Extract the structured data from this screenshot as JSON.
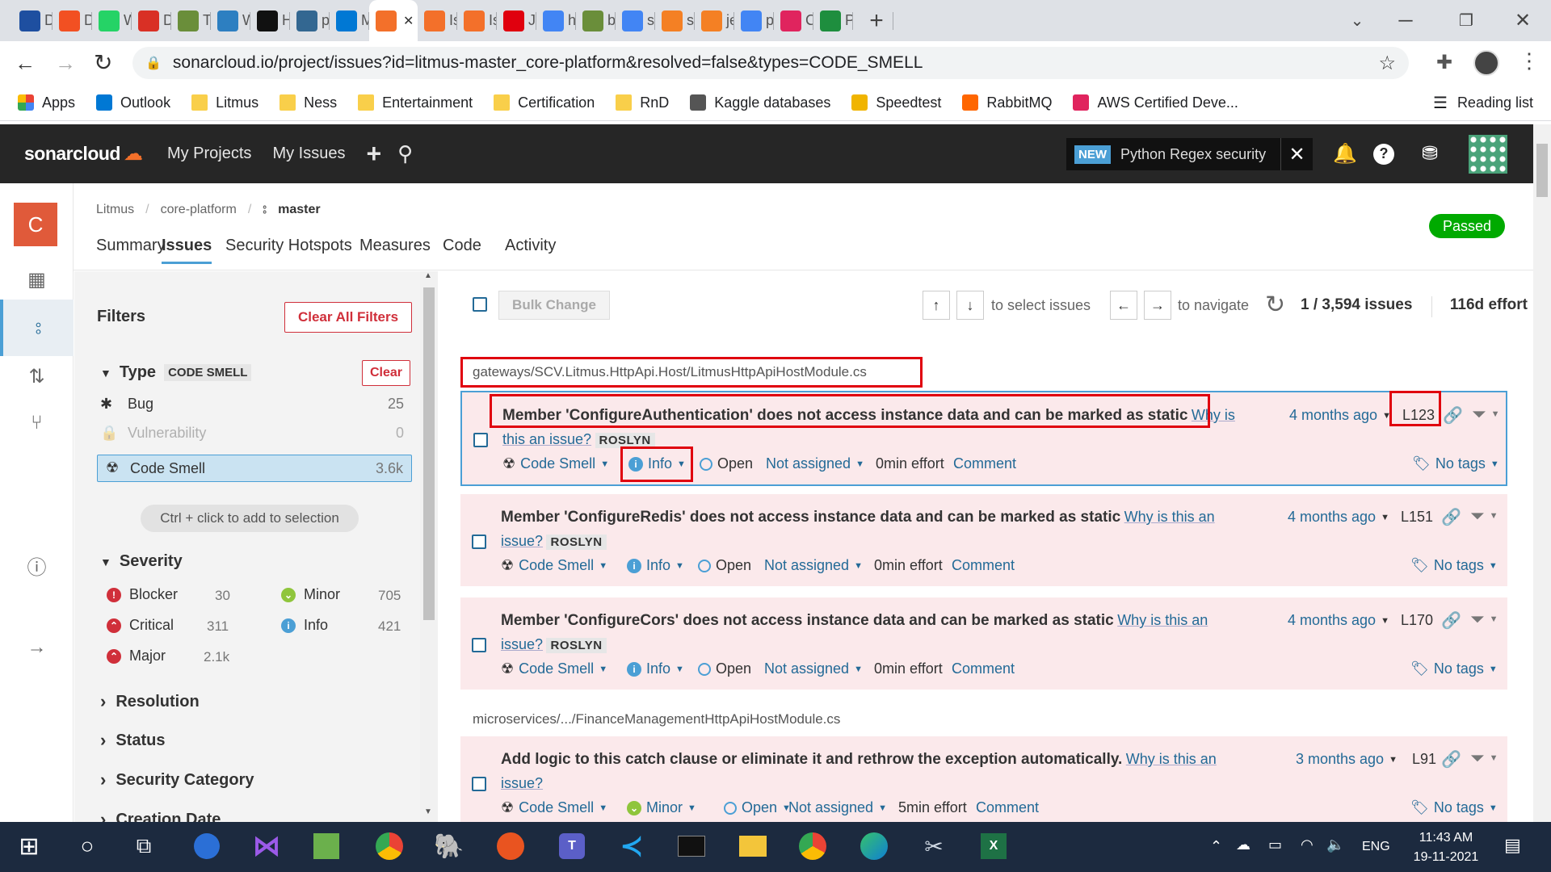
{
  "browser": {
    "tabs": [
      {
        "icon": "x-icon",
        "label": "D",
        "color": "#1e4fa0"
      },
      {
        "icon": "microsoft-icon",
        "label": "D",
        "color": "#f25022"
      },
      {
        "icon": "whatsapp-icon",
        "label": "W",
        "color": "#25d366"
      },
      {
        "icon": "feed-icon",
        "label": "D",
        "color": "#d93025"
      },
      {
        "icon": "tree-icon",
        "label": "Ti",
        "color": "#6a8e3a"
      },
      {
        "icon": "monitor-icon",
        "label": "W",
        "color": "#2d7fc1"
      },
      {
        "icon": "hacker-icon",
        "label": "H",
        "color": "#111111"
      },
      {
        "icon": "pg-icon",
        "label": "p",
        "color": "#336791"
      },
      {
        "icon": "outlook-icon",
        "label": "M",
        "color": "#0078d4"
      },
      {
        "icon": "sonarcloud-icon",
        "label": "",
        "color": "#f3702a",
        "active": true
      },
      {
        "icon": "sonarcloud-icon",
        "label": "Is",
        "color": "#f3702a"
      },
      {
        "icon": "sonarcloud-icon",
        "label": "Is",
        "color": "#f3702a"
      },
      {
        "icon": "oracle-icon",
        "label": "Ja",
        "color": "#e0000e"
      },
      {
        "icon": "google-icon",
        "label": "h",
        "color": "#4285f4"
      },
      {
        "icon": "tree-icon",
        "label": "bi",
        "color": "#6a8e3a"
      },
      {
        "icon": "google-icon",
        "label": "s",
        "color": "#4285f4"
      },
      {
        "icon": "stackoverflow-icon",
        "label": "s",
        "color": "#f48024"
      },
      {
        "icon": "stackoverflow-icon",
        "label": "je",
        "color": "#f48024"
      },
      {
        "icon": "google-icon",
        "label": "p",
        "color": "#4285f4"
      },
      {
        "icon": "heart-icon",
        "label": "C",
        "color": "#e0245e"
      },
      {
        "icon": "sheet-icon",
        "label": "P",
        "color": "#1e8e3e"
      }
    ],
    "new_tab": "+",
    "url": "sonarcloud.io/project/issues?id=litmus-master_core-platform&resolved=false&types=CODE_SMELL",
    "bookmarks": [
      {
        "label": "Apps",
        "icon": "apps-icon"
      },
      {
        "label": "Outlook",
        "icon": "outlook-icon"
      },
      {
        "label": "Litmus",
        "icon": "folder-icon"
      },
      {
        "label": "Ness",
        "icon": "folder-icon"
      },
      {
        "label": "Entertainment",
        "icon": "folder-icon"
      },
      {
        "label": "Certification",
        "icon": "folder-icon"
      },
      {
        "label": "RnD",
        "icon": "folder-icon"
      },
      {
        "label": "Kaggle databases",
        "icon": "globe-icon"
      },
      {
        "label": "Speedtest",
        "icon": "speedtest-icon"
      },
      {
        "label": "RabbitMQ",
        "icon": "rabbitmq-icon"
      },
      {
        "label": "AWS Certified Deve...",
        "icon": "aws-icon"
      }
    ],
    "reading_list": "Reading list"
  },
  "nav": {
    "logo": "sonarcloud",
    "my_projects": "My Projects",
    "my_issues": "My Issues",
    "new_badge": "NEW",
    "announcement": "Python Regex security"
  },
  "project": {
    "avatar_letter": "C",
    "breadcrumb": [
      "Litmus",
      "core-platform"
    ],
    "branch": "master",
    "quality_gate": "Passed",
    "tabs": [
      "Summary",
      "Issues",
      "Security Hotspots",
      "Measures",
      "Code",
      "Activity"
    ]
  },
  "filters": {
    "title": "Filters",
    "clear_all": "Clear All Filters",
    "type_label": "Type",
    "type_value": "CODE SMELL",
    "clear": "Clear",
    "types": [
      {
        "label": "Bug",
        "count": "25"
      },
      {
        "label": "Vulnerability",
        "count": "0"
      },
      {
        "label": "Code Smell",
        "count": "3.6k"
      }
    ],
    "hint": "Ctrl + click to add to selection",
    "severity_label": "Severity",
    "severities": [
      {
        "label": "Blocker",
        "count": "30"
      },
      {
        "label": "Minor",
        "count": "705"
      },
      {
        "label": "Critical",
        "count": "311"
      },
      {
        "label": "Info",
        "count": "421"
      },
      {
        "label": "Major",
        "count": "2.1k"
      }
    ],
    "sections": [
      "Resolution",
      "Status",
      "Security Category",
      "Creation Date"
    ]
  },
  "list": {
    "bulk_change": "Bulk Change",
    "select_hint": "to select issues",
    "nav_hint": "to navigate",
    "count": "1 / 3,594 issues",
    "effort": "116d effort"
  },
  "files": [
    "gateways/SCV.Litmus.HttpApi.Host/LitmusHttpApiHostModule.cs",
    "microservices/.../FinanceManagementHttpApiHostModule.cs"
  ],
  "issues": [
    {
      "title": "Member 'ConfigureAuthentication' does not access instance data and can be marked as static",
      "why1": "Why is",
      "why2": "this an issue?",
      "rule": "ROSLYN",
      "age": "4 months ago",
      "line": "L123",
      "type": "Code Smell",
      "severity": "Info",
      "status": "Open",
      "assignee": "Not assigned",
      "effort": "0min effort",
      "comment": "Comment",
      "tags": "No tags"
    },
    {
      "title": "Member 'ConfigureRedis' does not access instance data and can be marked as static",
      "why1": "Why is this an",
      "why2": "issue?",
      "rule": "ROSLYN",
      "age": "4 months ago",
      "line": "L151",
      "type": "Code Smell",
      "severity": "Info",
      "status": "Open",
      "assignee": "Not assigned",
      "effort": "0min effort",
      "comment": "Comment",
      "tags": "No tags"
    },
    {
      "title": "Member 'ConfigureCors' does not access instance data and can be marked as static",
      "why1": "Why is this an",
      "why2": "issue?",
      "rule": "ROSLYN",
      "age": "4 months ago",
      "line": "L170",
      "type": "Code Smell",
      "severity": "Info",
      "status": "Open",
      "assignee": "Not assigned",
      "effort": "0min effort",
      "comment": "Comment",
      "tags": "No tags"
    },
    {
      "title": "Add logic to this catch clause or eliminate it and rethrow the exception automatically.",
      "why1": "Why is this an",
      "why2": "issue?",
      "rule": "",
      "age": "3 months ago",
      "line": "L91",
      "type": "Code Smell",
      "severity": "Minor",
      "status": "Open",
      "assignee": "Not assigned",
      "effort": "5min effort",
      "comment": "Comment",
      "tags": "No tags"
    }
  ],
  "taskbar": {
    "time": "11:43 AM",
    "date": "19-11-2021",
    "lang": "ENG"
  }
}
